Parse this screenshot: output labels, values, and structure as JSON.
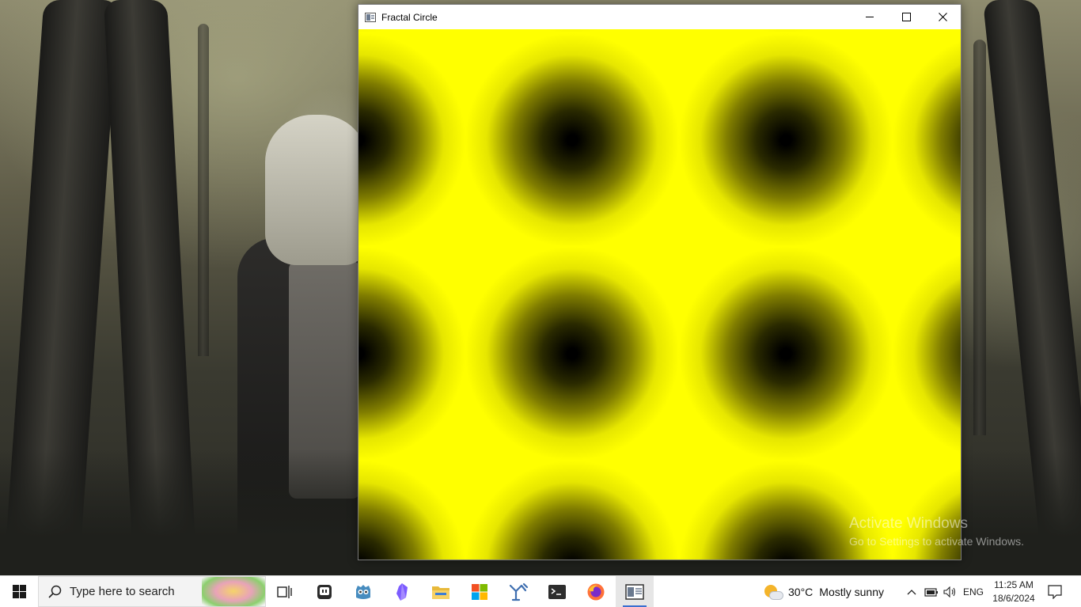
{
  "desktop": {
    "watermark": {
      "title": "Activate Windows",
      "subtitle": "Go to Settings to activate Windows."
    }
  },
  "window": {
    "title": "Fractal Circle",
    "icon": "app-window-icon",
    "controls": {
      "minimize_icon": "minimize-icon",
      "maximize_icon": "maximize-icon",
      "close_icon": "close-icon"
    },
    "canvas": {
      "colors": {
        "fill": "#ffff00",
        "center": "#000000"
      }
    }
  },
  "taskbar": {
    "start_icon": "windows-logo-icon",
    "search": {
      "placeholder": "Type here to search"
    },
    "pinned": [
      {
        "name": "task-view",
        "icon": "task-view-icon"
      },
      {
        "name": "chat",
        "icon": "chat-app-icon"
      },
      {
        "name": "godot",
        "icon": "godot-icon"
      },
      {
        "name": "obsidian",
        "icon": "obsidian-icon"
      },
      {
        "name": "file-explorer",
        "icon": "folder-icon"
      },
      {
        "name": "microsoft-store",
        "icon": "store-icon"
      },
      {
        "name": "visual-studio",
        "icon": "visual-studio-icon"
      },
      {
        "name": "terminal",
        "icon": "terminal-icon"
      },
      {
        "name": "firefox",
        "icon": "firefox-icon"
      },
      {
        "name": "fractal-circle",
        "icon": "app-window-icon"
      }
    ],
    "weather": {
      "temp": "30°C",
      "desc": "Mostly sunny"
    },
    "tray": {
      "lang": "ENG",
      "chevron": "^"
    },
    "clock": {
      "time": "11:25 AM",
      "date": "18/6/2024"
    }
  }
}
